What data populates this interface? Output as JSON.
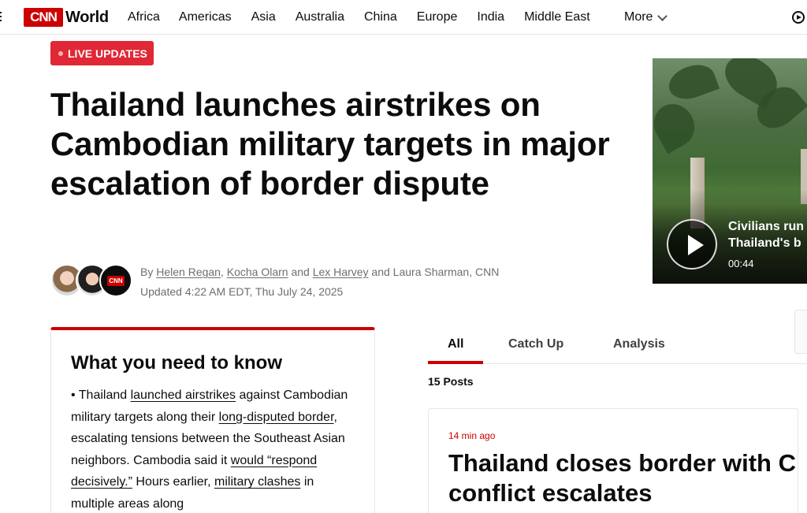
{
  "nav": {
    "logo": "CNN",
    "section": "World",
    "items": [
      "Africa",
      "Americas",
      "Asia",
      "Australia",
      "China",
      "Europe",
      "India",
      "Middle East"
    ],
    "more_label": "More"
  },
  "live_label": "LIVE UPDATES",
  "headline": "Thailand launches airstrikes on Cambodian military targets in major escalation of border dispute",
  "byline": {
    "by": "By",
    "authors": [
      "Helen Regan",
      "Kocha Olarn",
      "Lex Harvey",
      "Laura Sharman"
    ],
    "sep1": ",",
    "and": "and",
    "outlet": ", CNN",
    "updated": "Updated 4:22 AM EDT, Thu July 24, 2025",
    "avatar_logo": "CNN"
  },
  "video": {
    "title_line1": "Civilians run",
    "title_line2": "Thailand's b",
    "duration": "00:44"
  },
  "know": {
    "heading": "What you need to know",
    "bullet": "•",
    "t1": "Thailand",
    "l1": "launched airstrikes",
    "t2": "against Cambodian military targets along their",
    "l2": "long-disputed border",
    "t3": ", escalating tensions between the Southeast Asian neighbors. Cambodia said it",
    "l3": "would “respond decisively.”",
    "t4": "Hours earlier,",
    "l4": "military clashes",
    "t5": "in multiple areas along"
  },
  "tabs": [
    "All",
    "Catch Up",
    "Analysis"
  ],
  "posts_count": "15 Posts",
  "post": {
    "time": "14 min ago",
    "title_line1": "Thailand closes border with C",
    "title_line2": "conflict escalates"
  },
  "colors": {
    "brand": "#cc0000",
    "live": "#e02836"
  }
}
